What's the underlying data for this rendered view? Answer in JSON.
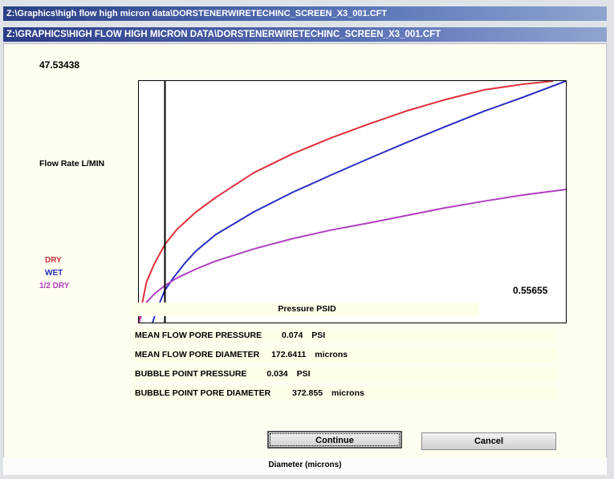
{
  "window": {
    "path_title": "Z:\\Graphics\\high flow high micron data\\DORSTENERWIRETECHINC_SCREEN_X3_001.CFT",
    "upper_title": "Z:\\GRAPHICS\\HIGH FLOW HIGH MICRON DATA\\DORSTENERWIRETECHINC_SCREEN_X3_001.CFT"
  },
  "chart_data": {
    "type": "line",
    "ylabel": "Flow Rate L/MIN",
    "xlabel": "Pressure PSID",
    "ymax_label": "47.53438",
    "xmax_label": "0.55655",
    "xlim": [
      0,
      0.55655
    ],
    "ylim": [
      0,
      47.53438
    ],
    "marker_x": 0.034,
    "series": [
      {
        "name": "DRY",
        "color": "#e0303a",
        "x": [
          0,
          0.004,
          0.01,
          0.02,
          0.034,
          0.05,
          0.074,
          0.1,
          0.15,
          0.2,
          0.25,
          0.3,
          0.35,
          0.4,
          0.45,
          0.5,
          0.54
        ],
        "y": [
          0,
          3.5,
          8.0,
          11.5,
          15.4,
          18.4,
          21.7,
          24.6,
          29.5,
          33.2,
          36.3,
          39.1,
          41.7,
          43.9,
          45.8,
          46.9,
          47.53
        ]
      },
      {
        "name": "WET",
        "color": "#2b2fc2",
        "x": [
          0.018,
          0.022,
          0.028,
          0.034,
          0.045,
          0.06,
          0.074,
          0.1,
          0.15,
          0.2,
          0.25,
          0.3,
          0.35,
          0.4,
          0.45,
          0.5,
          0.55655
        ],
        "y": [
          0,
          2.0,
          4.2,
          6.4,
          8.8,
          11.7,
          14.0,
          17.3,
          21.8,
          25.6,
          29.0,
          32.3,
          35.5,
          38.6,
          41.6,
          44.3,
          47.53
        ]
      },
      {
        "name": "1/2 DRY",
        "color": "#b040c0",
        "x": [
          0,
          0.005,
          0.01,
          0.02,
          0.034,
          0.05,
          0.074,
          0.1,
          0.15,
          0.2,
          0.25,
          0.3,
          0.35,
          0.4,
          0.45,
          0.5,
          0.55655
        ],
        "y": [
          0,
          2.0,
          4.0,
          5.6,
          7.3,
          8.8,
          10.5,
          12.1,
          14.5,
          16.5,
          18.2,
          19.6,
          21.1,
          22.6,
          23.9,
          25.1,
          26.2
        ]
      }
    ]
  },
  "legend": {
    "dry": "DRY",
    "wet": "WET",
    "half_dry": "1/2 DRY"
  },
  "results": {
    "mean_flow_pore_pressure": {
      "label": "MEAN FLOW PORE PRESSURE",
      "value": "0.074",
      "unit": "PSI"
    },
    "mean_flow_pore_diameter": {
      "label": "MEAN FLOW PORE DIAMETER",
      "value": "172.6411",
      "unit": "microns"
    },
    "bubble_point_pressure": {
      "label": "BUBBLE POINT PRESSURE",
      "value": "0.034",
      "unit": "PSI"
    },
    "bubble_point_pore_diameter": {
      "label": "BUBBLE POINT PORE DIAMETER",
      "value": "372.855",
      "unit": "microns"
    }
  },
  "buttons": {
    "continue": "Continue",
    "cancel": "Cancel"
  },
  "status": {
    "text": "Diameter (microns)"
  }
}
